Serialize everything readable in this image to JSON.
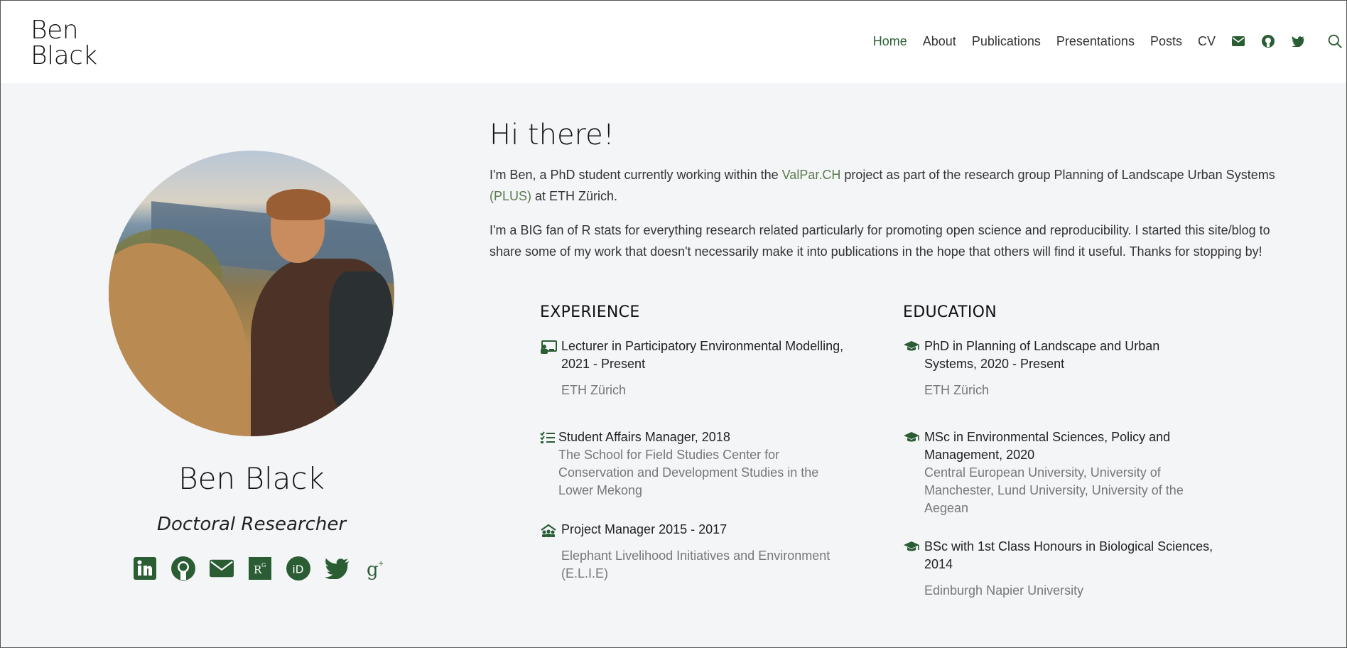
{
  "brand": {
    "line1": "Ben",
    "line2": "Black"
  },
  "nav": {
    "items": [
      "Home",
      "About",
      "Publications",
      "Presentations",
      "Posts",
      "CV"
    ],
    "icons": [
      "envelope-icon",
      "github-icon",
      "twitter-icon"
    ],
    "search_icon": "search-icon"
  },
  "colors": {
    "accent": "#2b5d34",
    "link": "#5b7a4f",
    "background": "#f4f5f7",
    "muted": "#777777"
  },
  "profile": {
    "name": "Ben Black",
    "role": "Doctoral Researcher",
    "social_icons": [
      "linkedin-icon",
      "github-icon",
      "envelope-icon",
      "researchgate-icon",
      "orcid-icon",
      "twitter-icon",
      "google-scholar-icon"
    ]
  },
  "intro": {
    "heading": "Hi there!",
    "p1_a": "I'm Ben, a PhD student currently working within the ",
    "p1_link1": "ValPar.CH",
    "p1_b": " project as part of the research group Planning of Landscape Urban Systems ",
    "p1_link2": "(PLUS)",
    "p1_c": " at ETH Zürich.",
    "p2": "I'm a BIG fan of R stats for everything research related particularly for promoting open science and reproducibility. I started this site/blog to share some of my work that doesn't necessarily make it into publications in the hope that others will find it useful. Thanks for stopping by!"
  },
  "experience": {
    "heading": "EXPERIENCE",
    "items": [
      {
        "icon": "chalkboard-teacher-icon",
        "title": "Lecturer in Participatory Environmental Modelling, 2021 - Present",
        "org": "ETH Zürich"
      },
      {
        "icon": "tasks-icon",
        "title": "Student Affairs Manager, 2018",
        "org": "The School for Field Studies Center for Conservation and Development Studies in the Lower Mekong"
      },
      {
        "icon": "project-diagram-icon",
        "title": "Project Manager 2015 - 2017",
        "org": "Elephant Livelihood Initiatives and Environment (E.L.I.E)"
      }
    ]
  },
  "education": {
    "heading": "EDUCATION",
    "items": [
      {
        "icon": "graduation-cap-icon",
        "title": "PhD in Planning of Landscape and Urban Systems, 2020 - Present",
        "org": "ETH Zürich"
      },
      {
        "icon": "graduation-cap-icon",
        "title": "MSc in Environmental Sciences, Policy and Management, 2020",
        "org": "Central European University, University of Manchester, Lund University, University of the Aegean"
      },
      {
        "icon": "graduation-cap-icon",
        "title": "BSc with 1st Class Honours in Biological Sciences, 2014",
        "org": "Edinburgh Napier University"
      }
    ]
  }
}
